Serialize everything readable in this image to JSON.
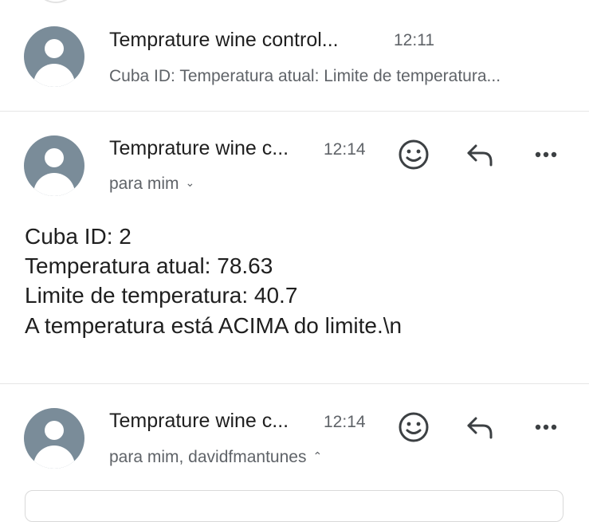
{
  "thread": [
    {
      "sender": "Temprature wine control...",
      "time": "12:11",
      "preview": "Cuba ID: Temperatura atual: Limite de temperatura..."
    },
    {
      "sender": "Temprature wine c...",
      "time": "12:14",
      "recipients": "para mim",
      "body": [
        "Cuba ID: 2",
        "Temperatura atual: 78.63",
        "Limite de temperatura: 40.7",
        "A temperatura está ACIMA do limite.\\n"
      ],
      "icons": [
        "emoji-reaction-icon",
        "reply-icon",
        "more-options-icon"
      ]
    },
    {
      "sender": "Temprature wine c...",
      "time": "12:14",
      "recipients": "para mim, davidfmantunes",
      "icons": [
        "emoji-reaction-icon",
        "reply-icon",
        "more-options-icon"
      ]
    }
  ],
  "colors": {
    "avatar": "#7a8c99",
    "secondary_text": "#5f6368",
    "icon": "#3c4043",
    "divider": "#e6e6e6"
  }
}
